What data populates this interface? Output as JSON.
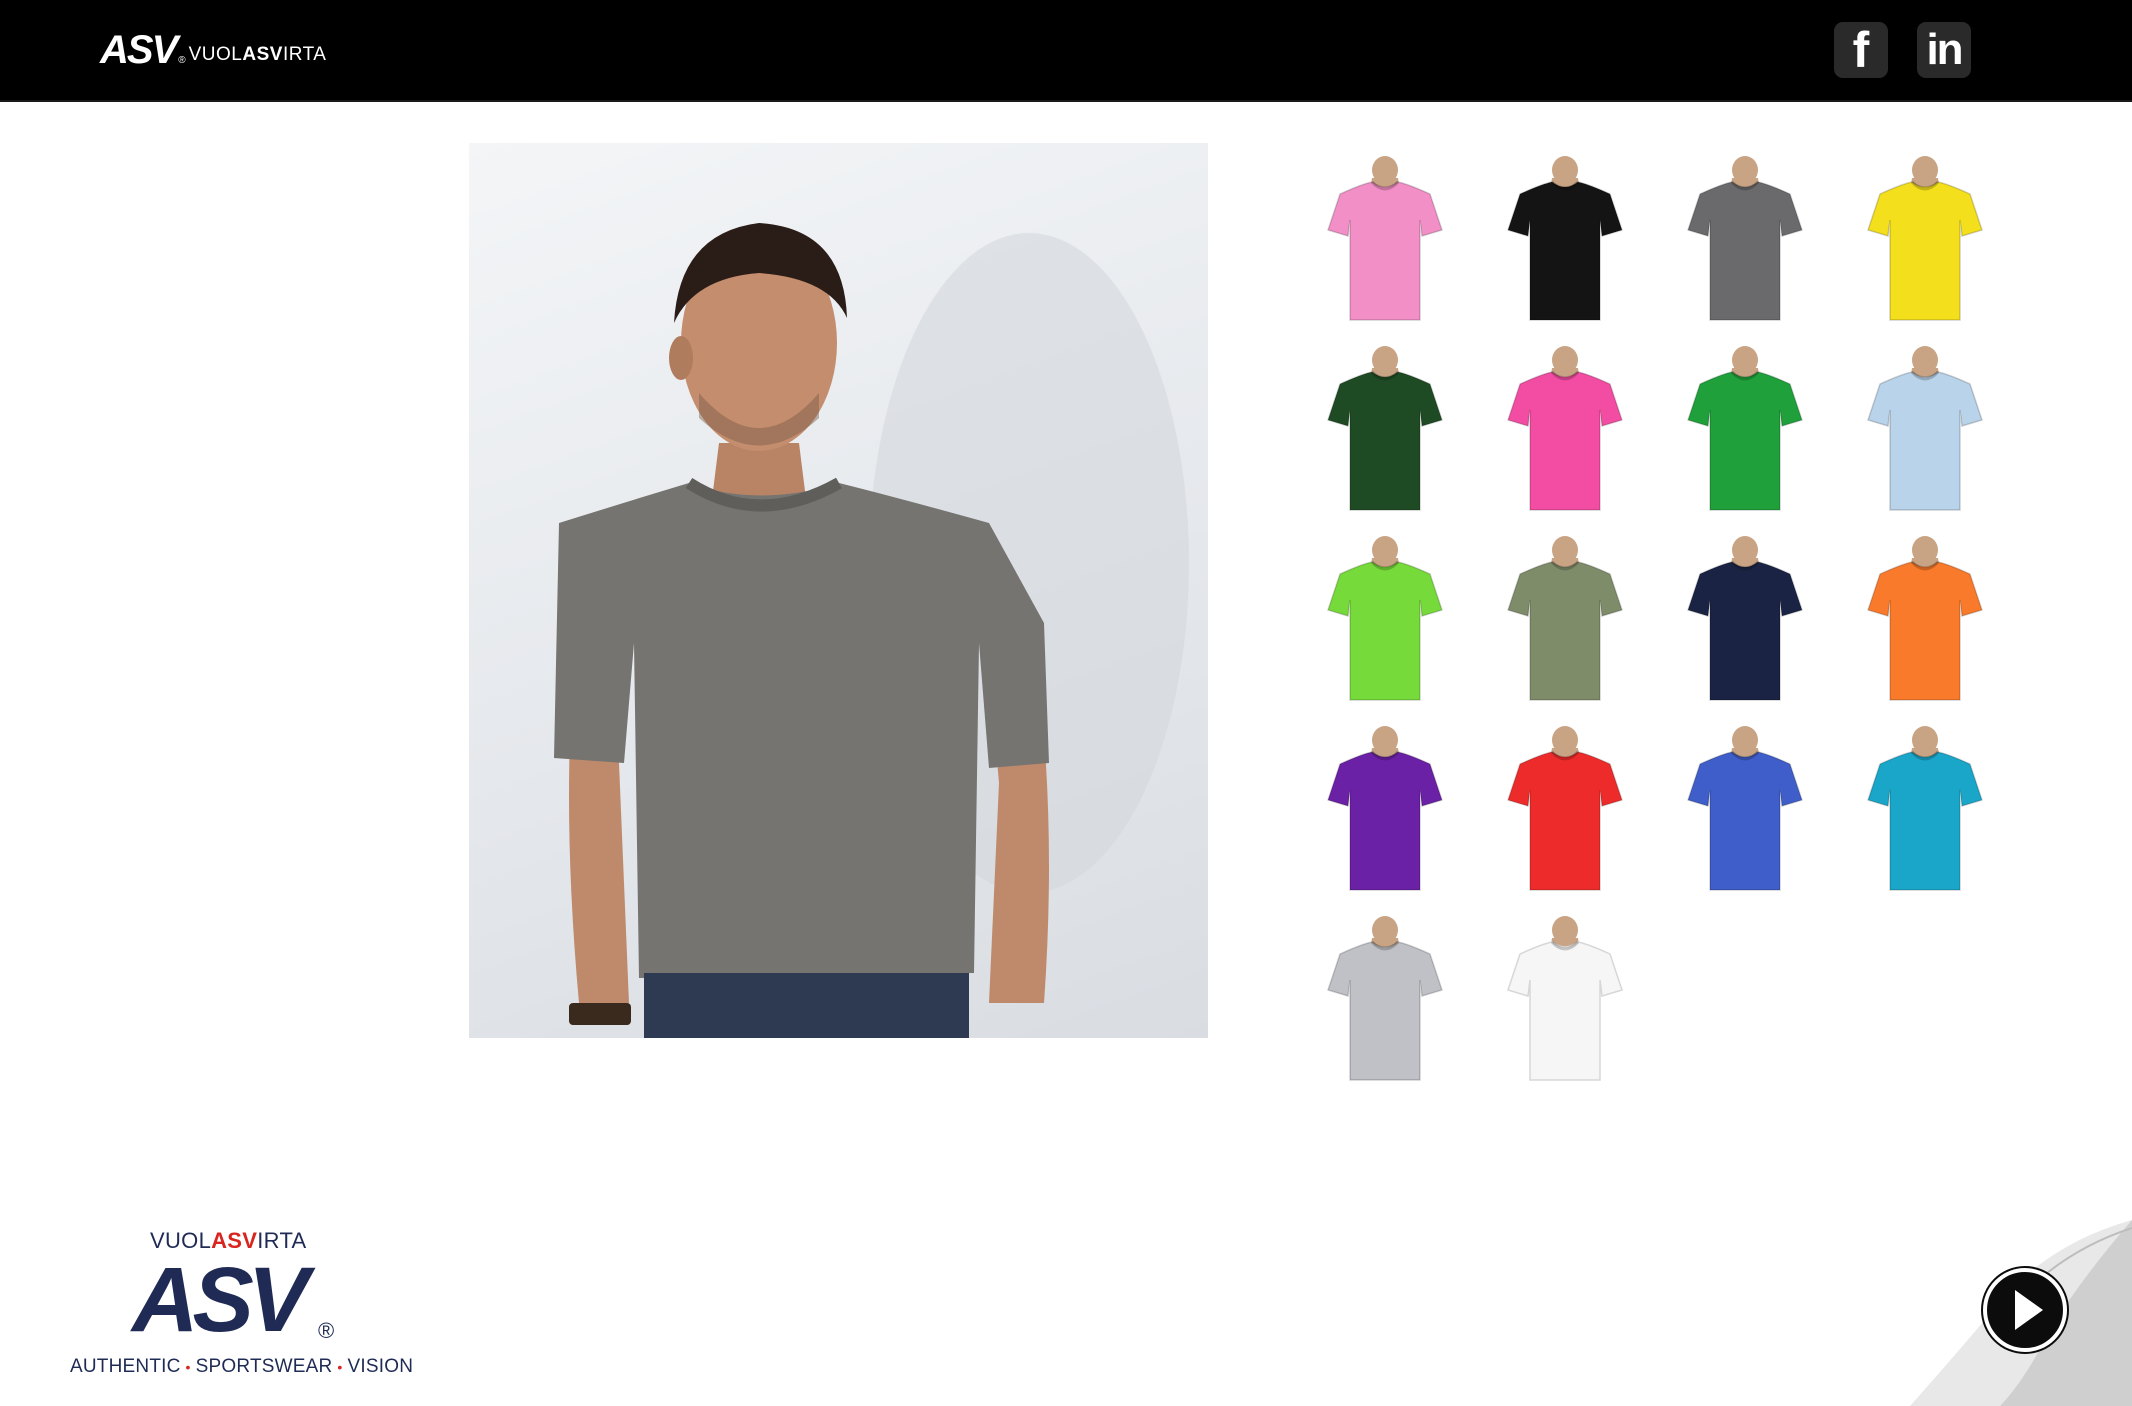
{
  "header": {
    "brand_logo": "ASV",
    "brand_reg": "®",
    "brand_tag_pre": "VUOL",
    "brand_tag_bold": "ASV",
    "brand_tag_post": "IRTA",
    "social": [
      {
        "label": "f",
        "icon": "facebook-icon"
      },
      {
        "label": "in",
        "icon": "linkedin-icon"
      }
    ]
  },
  "product_colors": [
    {
      "name": "pink",
      "color": "#f28fc6"
    },
    {
      "name": "black",
      "color": "#141414"
    },
    {
      "name": "charcoal",
      "color": "#6a6a6c"
    },
    {
      "name": "yellow",
      "color": "#f4df1c"
    },
    {
      "name": "bottle-green",
      "color": "#1f4b24"
    },
    {
      "name": "fuchsia",
      "color": "#f24da2"
    },
    {
      "name": "green",
      "color": "#1fa03a"
    },
    {
      "name": "light-blue",
      "color": "#b9d3ea"
    },
    {
      "name": "lime",
      "color": "#76da3a"
    },
    {
      "name": "olive",
      "color": "#7f8c6a"
    },
    {
      "name": "navy",
      "color": "#1a2344"
    },
    {
      "name": "orange",
      "color": "#f97a2a"
    },
    {
      "name": "purple",
      "color": "#6b21a5"
    },
    {
      "name": "red",
      "color": "#ee2b2b"
    },
    {
      "name": "royal-blue",
      "color": "#3f5ec9"
    },
    {
      "name": "turquoise",
      "color": "#1aa6c9"
    },
    {
      "name": "heather-grey",
      "color": "#bfc1c6"
    },
    {
      "name": "white",
      "color": "#f6f6f6"
    }
  ],
  "footer": {
    "tag_pre": "VUOL",
    "tag_bold": "ASV",
    "tag_post": "IRTA",
    "mark": "ASV",
    "reg": "®",
    "slogan": [
      "AUTHENTIC",
      "SPORTSWEAR",
      "VISION"
    ],
    "slogan_dot": "•"
  },
  "navigation": {
    "next_icon": "play-icon"
  }
}
